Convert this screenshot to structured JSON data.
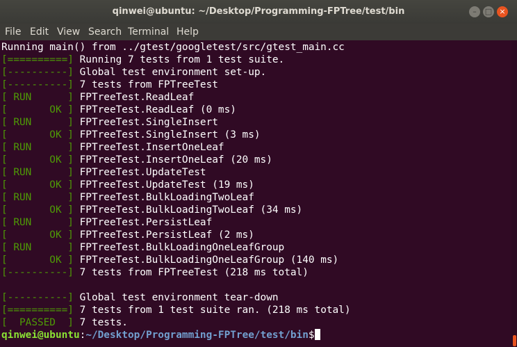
{
  "window": {
    "title": "qinwei@ubuntu: ~/Desktop/Programming-FPTree/test/bin",
    "minimize_glyph": "–",
    "maximize_glyph": "□",
    "close_glyph": "×"
  },
  "menu": [
    "File",
    "Edit",
    "View",
    "Search",
    "Terminal",
    "Help"
  ],
  "terminal": {
    "lines": [
      {
        "tag": "",
        "text": "Running main() from ../gtest/googletest/src/gtest_main.cc"
      },
      {
        "tag": "[==========]",
        "text": " Running 7 tests from 1 test suite."
      },
      {
        "tag": "[----------]",
        "text": " Global test environment set-up."
      },
      {
        "tag": "[----------]",
        "text": " 7 tests from FPTreeTest"
      },
      {
        "tag": "[ RUN      ]",
        "text": " FPTreeTest.ReadLeaf"
      },
      {
        "tag": "[       OK ]",
        "text": " FPTreeTest.ReadLeaf (0 ms)"
      },
      {
        "tag": "[ RUN      ]",
        "text": " FPTreeTest.SingleInsert"
      },
      {
        "tag": "[       OK ]",
        "text": " FPTreeTest.SingleInsert (3 ms)"
      },
      {
        "tag": "[ RUN      ]",
        "text": " FPTreeTest.InsertOneLeaf"
      },
      {
        "tag": "[       OK ]",
        "text": " FPTreeTest.InsertOneLeaf (20 ms)"
      },
      {
        "tag": "[ RUN      ]",
        "text": " FPTreeTest.UpdateTest"
      },
      {
        "tag": "[       OK ]",
        "text": " FPTreeTest.UpdateTest (19 ms)"
      },
      {
        "tag": "[ RUN      ]",
        "text": " FPTreeTest.BulkLoadingTwoLeaf"
      },
      {
        "tag": "[       OK ]",
        "text": " FPTreeTest.BulkLoadingTwoLeaf (34 ms)"
      },
      {
        "tag": "[ RUN      ]",
        "text": " FPTreeTest.PersistLeaf"
      },
      {
        "tag": "[       OK ]",
        "text": " FPTreeTest.PersistLeaf (2 ms)"
      },
      {
        "tag": "[ RUN      ]",
        "text": " FPTreeTest.BulkLoadingOneLeafGroup"
      },
      {
        "tag": "[       OK ]",
        "text": " FPTreeTest.BulkLoadingOneLeafGroup (140 ms)"
      },
      {
        "tag": "[----------]",
        "text": " 7 tests from FPTreeTest (218 ms total)"
      },
      {
        "tag": "",
        "text": ""
      },
      {
        "tag": "[----------]",
        "text": " Global test environment tear-down"
      },
      {
        "tag": "[==========]",
        "text": " 7 tests from 1 test suite ran. (218 ms total)"
      },
      {
        "tag": "[  PASSED  ]",
        "text": " 7 tests."
      }
    ],
    "prompt": {
      "user_host": "qinwei@ubuntu",
      "separator": ":",
      "path": "~/Desktop/Programming-FPTree/test/bin",
      "symbol": "$"
    }
  },
  "colors": {
    "background": "#300a24",
    "tag_green": "#4e9a06",
    "prompt_user": "#8ae234",
    "prompt_path": "#729fcf",
    "close_button": "#e95420"
  }
}
